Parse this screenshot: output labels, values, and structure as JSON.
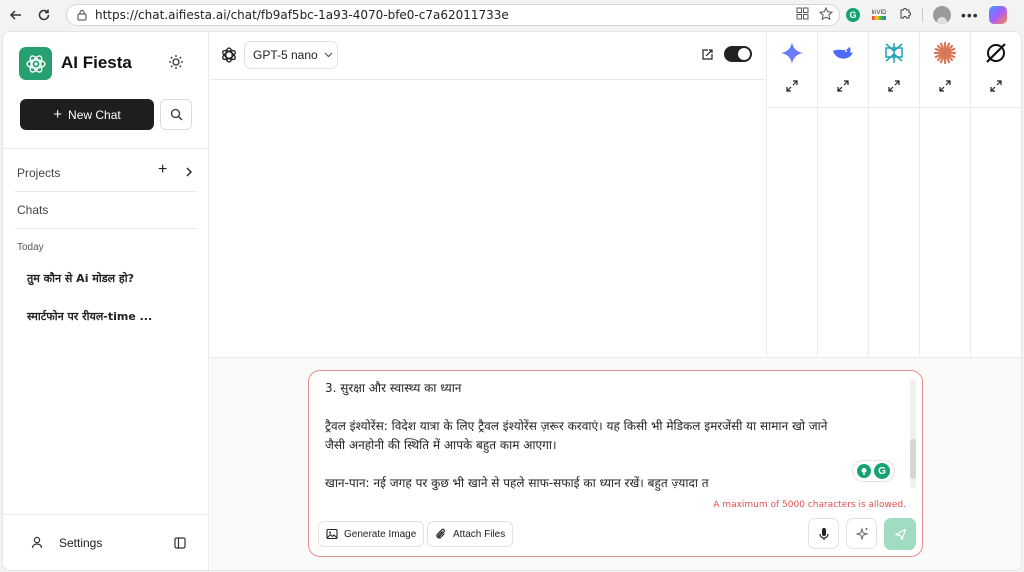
{
  "browser": {
    "url": "https://chat.aifiesta.ai/chat/fb9af5bc-1a93-4070-bfe0-c7a62011733e",
    "ext_badge": "InVID"
  },
  "sidebar": {
    "brand": "AI Fiesta",
    "new_chat": "New Chat",
    "projects_label": "Projects",
    "chats_label": "Chats",
    "today_label": "Today",
    "chats": [
      "तुम कौन से Ai मोडल हो?",
      "स्मार्टफोन पर रीयल-time ..."
    ],
    "settings_label": "Settings"
  },
  "main": {
    "model_name": "GPT-5 nano"
  },
  "composer": {
    "text": "3. सुरक्षा और स्वास्थ्य का ध्यान\n\nट्रैवल इंश्योरेंस: विदेश यात्रा के लिए ट्रैवल इंश्योरेंस ज़रूर करवाएं। यह किसी भी मेडिकल इमरजेंसी या सामान खो जाने\nजैसी अनहोनी की स्थिति में आपके बहुत काम आएगा।\n\nखान-पान: नई जगह पर कुछ भी खाने से पहले साफ-सफाई का ध्यान रखें। बहुत ज़्यादा त",
    "limit_message": "A maximum of 5000 characters is allowed.",
    "generate_image": "Generate Image",
    "attach_files": "Attach Files"
  },
  "colors": {
    "accent_green": "#25a06e",
    "error_red": "#e25252",
    "send_disabled": "#9fdcc1",
    "border_red": "#e88d8d"
  }
}
